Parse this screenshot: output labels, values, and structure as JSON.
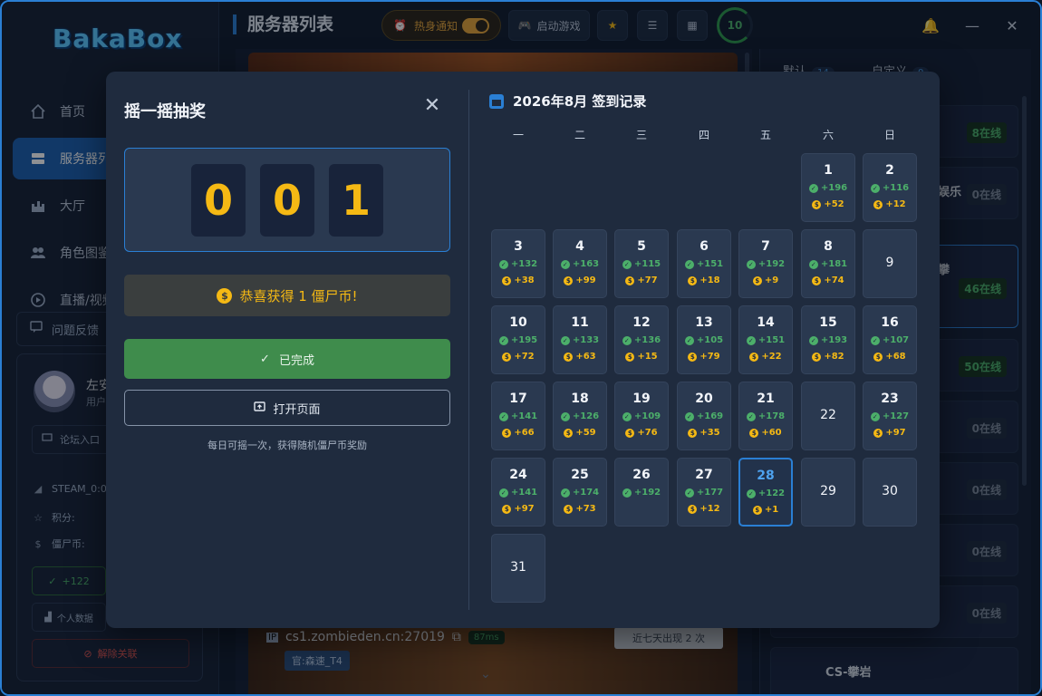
{
  "app": {
    "logo": "BakaBox"
  },
  "sidebar": {
    "items": [
      {
        "label": "首页",
        "icon": "home-icon"
      },
      {
        "label": "服务器列表",
        "icon": "server-icon"
      },
      {
        "label": "大厅",
        "icon": "castle-icon"
      },
      {
        "label": "角色图鉴",
        "icon": "users-icon"
      },
      {
        "label": "直播/视频",
        "icon": "play-icon"
      }
    ],
    "feedback": "问题反馈",
    "user": {
      "name": "左安",
      "sub": "用户",
      "forum": "论坛入口",
      "steam": "STEAM_0:0",
      "points_label": "积分:",
      "coins_label": "僵尸币:",
      "sign_value": "+122",
      "stats": "个人数据",
      "unbind": "解除关联"
    }
  },
  "header": {
    "title": "服务器列表",
    "hot_notify": "热身通知",
    "hot_notify_on": true,
    "launch": "启动游戏",
    "ring_value": "10"
  },
  "background": {
    "address": "cs1.zombieden.cn:27019",
    "ping": "87ms",
    "seen": "近七天出现 2 次",
    "tag": "官:森速_T4",
    "right_tabs": [
      {
        "label": "默认",
        "count": "14"
      },
      {
        "label": "自定义",
        "count": "0"
      }
    ],
    "right_cards": [
      {
        "name": "",
        "online": "8在线",
        "status": "green"
      },
      {
        "name": "娱乐",
        "online": "0在线",
        "status": "zero"
      },
      {
        "name": "攀",
        "online": "46在线",
        "status": "green"
      },
      {
        "name": "",
        "online": "50在线",
        "status": "green"
      },
      {
        "name": "",
        "online": "0在线",
        "status": "zero"
      },
      {
        "name": "",
        "online": "0在线",
        "status": "zero"
      },
      {
        "name": "",
        "online": "0在线",
        "status": "zero"
      },
      {
        "name": "",
        "online": "0在线",
        "status": "zero"
      },
      {
        "name": "CS-攀岩",
        "online": "",
        "status": "zero"
      }
    ]
  },
  "lottery": {
    "title": "摇一摇抽奖",
    "digits": [
      "0",
      "0",
      "1"
    ],
    "congrats": "恭喜获得 1 僵尸币!",
    "done": "已完成",
    "open_page": "打开页面",
    "hint": "每日可摇一次，获得随机僵尸币奖励"
  },
  "calendar": {
    "title": "2026年8月 签到记录",
    "weekdays": [
      "一",
      "二",
      "三",
      "四",
      "五",
      "六",
      "日"
    ],
    "first_weekday_index": 5,
    "today": 28,
    "days": [
      {
        "d": "1",
        "a": "+196",
        "b": "+52"
      },
      {
        "d": "2",
        "a": "+116",
        "b": "+12"
      },
      {
        "d": "3",
        "a": "+132",
        "b": "+38"
      },
      {
        "d": "4",
        "a": "+163",
        "b": "+99"
      },
      {
        "d": "5",
        "a": "+115",
        "b": "+77"
      },
      {
        "d": "6",
        "a": "+151",
        "b": "+18"
      },
      {
        "d": "7",
        "a": "+192",
        "b": "+9"
      },
      {
        "d": "8",
        "a": "+181",
        "b": "+74"
      },
      {
        "d": "9",
        "a": "",
        "b": ""
      },
      {
        "d": "10",
        "a": "+195",
        "b": "+72"
      },
      {
        "d": "11",
        "a": "+133",
        "b": "+63"
      },
      {
        "d": "12",
        "a": "+136",
        "b": "+15"
      },
      {
        "d": "13",
        "a": "+105",
        "b": "+79"
      },
      {
        "d": "14",
        "a": "+151",
        "b": "+22"
      },
      {
        "d": "15",
        "a": "+193",
        "b": "+82"
      },
      {
        "d": "16",
        "a": "+107",
        "b": "+68"
      },
      {
        "d": "17",
        "a": "+141",
        "b": "+66"
      },
      {
        "d": "18",
        "a": "+126",
        "b": "+59"
      },
      {
        "d": "19",
        "a": "+109",
        "b": "+76"
      },
      {
        "d": "20",
        "a": "+169",
        "b": "+35"
      },
      {
        "d": "21",
        "a": "+178",
        "b": "+60"
      },
      {
        "d": "22",
        "a": "",
        "b": ""
      },
      {
        "d": "23",
        "a": "+127",
        "b": "+97"
      },
      {
        "d": "24",
        "a": "+141",
        "b": "+97"
      },
      {
        "d": "25",
        "a": "+174",
        "b": "+73"
      },
      {
        "d": "26",
        "a": "+192",
        "b": ""
      },
      {
        "d": "27",
        "a": "+177",
        "b": "+12"
      },
      {
        "d": "28",
        "a": "+122",
        "b": "+1"
      },
      {
        "d": "29",
        "a": "",
        "b": ""
      },
      {
        "d": "30",
        "a": "",
        "b": ""
      },
      {
        "d": "31",
        "a": "",
        "b": ""
      }
    ]
  },
  "colors": {
    "accent": "#2a7fd4",
    "gold": "#f5b914",
    "green": "#4caf6a",
    "modal": "#1f2b3e"
  }
}
